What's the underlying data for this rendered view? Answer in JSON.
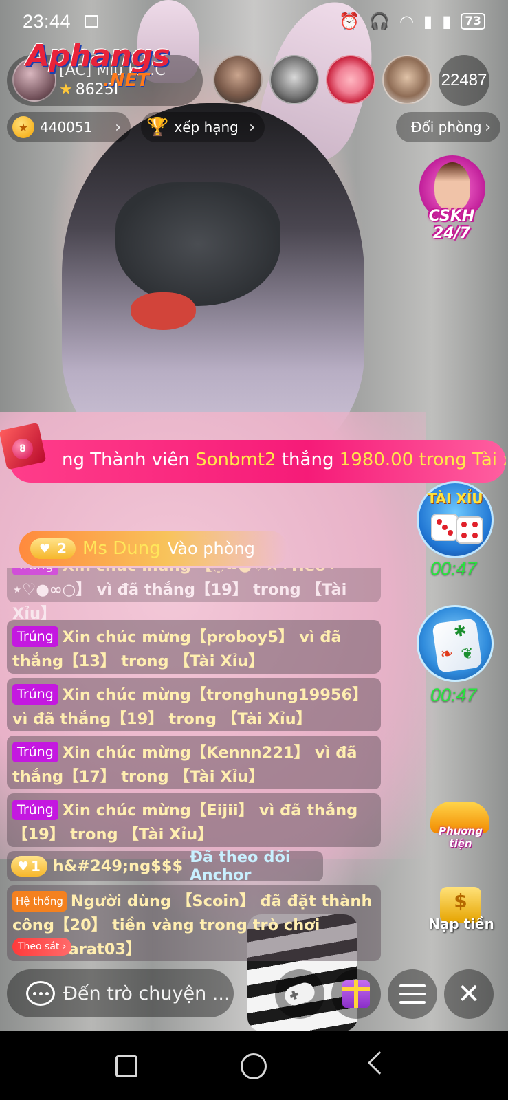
{
  "status_bar": {
    "time": "23:44",
    "battery": "73"
  },
  "logo": {
    "main": "Aphangs",
    "suffix": ".NET"
  },
  "host": {
    "name": "[AC] Miu lc...C",
    "score": "8625I"
  },
  "viewers": {
    "count": "22487"
  },
  "pills": {
    "coins": "440051",
    "ranking": "xếp hạng",
    "change_room": "Đổi phòng"
  },
  "cskh": {
    "label": "CSKH 24/7"
  },
  "marquee": {
    "prefix": "ng Thành viên ",
    "user": "Sonbmt2",
    "middle": " thắng ",
    "amount": "1980.00 trong Tài x",
    "ball_number": "8"
  },
  "games": {
    "taixiu_label": "TÀI XỈU",
    "taixiu_timer": "00:47",
    "baucua_timer": "00:47",
    "phuongtien_label": "Phương tiện",
    "naptien_label": "Nạp tiền"
  },
  "enter_notice": {
    "level": "2",
    "user": "Ms Dung",
    "action": "Vào phòng"
  },
  "chat": {
    "tag": "Trúng",
    "messages": [
      {
        "text": "Xin chúc mừng 【★♡●∽○ ★♡ Heo 】 vì đã thắng【19】 trong 【Tài Xỉu】",
        "display_line1": "Xin chúc mừng 【◌∞●♡×❤Heo❤",
        "display_line2": "⋆♡●∞○】 vì đã thắng【19】 trong 【Tài Xỉu】"
      },
      {
        "text": "Xin chúc mừng【proboy5】 vì đã thắng【13】 trong 【Tài Xỉu】"
      },
      {
        "text": "Xin chúc mừng【tronghung19956】 vì đã thắng【19】 trong 【Tài Xỉu】"
      },
      {
        "text": "Xin chúc mừng【Kennn221】 vì đã thắng【17】 trong 【Tài Xỉu】"
      },
      {
        "text": "Xin chúc mừng【Eijii】 vì đã thắng【19】 trong 【Tài Xỉu】"
      }
    ],
    "follow": {
      "level": "1",
      "name": "h&#249;ng$$$",
      "action": "Đã theo dõi Anchor"
    },
    "system": {
      "tag": "Hệ thống",
      "text": "Người dùng 【Scoin】 đã đặt thành công【20】 tiền vàng trong trò chơi【Baccarat03】",
      "button": "Theo sát"
    }
  },
  "bottom_bar": {
    "chat_placeholder": "Đến trò chuyện ..."
  },
  "colors": {
    "marquee": "#f61b78",
    "highlight": "#ffe74a",
    "timer": "#27e63e",
    "win_tag": "#c418e0",
    "system_tag": "#f4811f"
  }
}
